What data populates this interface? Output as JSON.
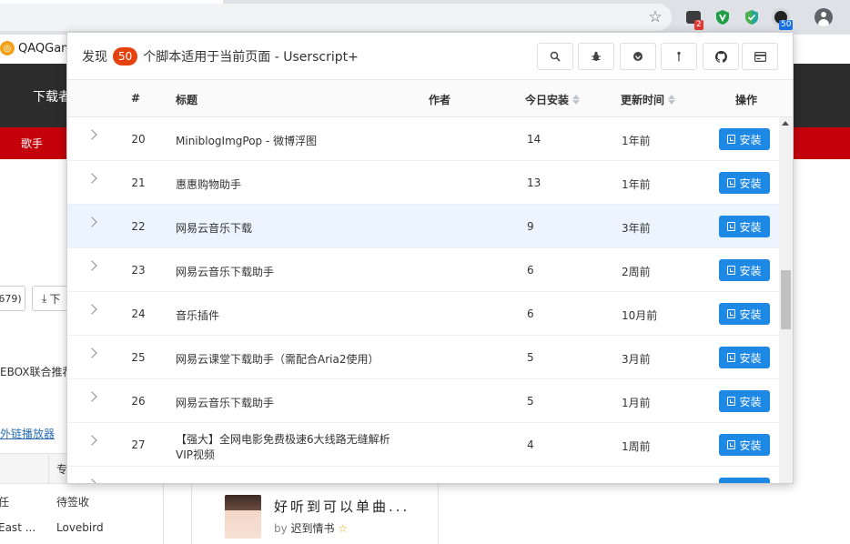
{
  "browser": {
    "ext_badge_1": "2",
    "ext_badge_2": "50",
    "star_icon": "☆"
  },
  "background_page": {
    "tab_title": "QAQGam",
    "nav_item": "下载者",
    "subnav_item": "歌手",
    "count_box": "679)",
    "download_button": "下",
    "text_1": "EBOX联合推荐",
    "link": "外链播放器",
    "table": {
      "header_cell": "专",
      "row1": [
        "任",
        "待签收"
      ],
      "row2": [
        "East ...",
        "Lovebird"
      ]
    },
    "card": {
      "title": "好听到可以单曲...",
      "by": "by",
      "author": "迟到情书"
    }
  },
  "popup": {
    "title_prefix": "发现",
    "count": "50",
    "title_suffix": "个脚本适用于当前页面 - Userscript+",
    "toolbar": [
      "search-icon",
      "bug-icon",
      "shield-icon",
      "pin-icon",
      "github-icon",
      "card-icon"
    ],
    "columns": {
      "num": "#",
      "title": "标题",
      "author": "作者",
      "installs": "今日安装",
      "updated": "更新时间",
      "action": "操作"
    },
    "install_label": "安装",
    "rows": [
      {
        "num": "20",
        "title": "MiniblogImgPop - 微博浮图",
        "installs": "14",
        "updated": "1年前"
      },
      {
        "num": "21",
        "title": "惠惠购物助手",
        "installs": "13",
        "updated": "1年前"
      },
      {
        "num": "22",
        "title": "网易云音乐下载",
        "installs": "9",
        "updated": "3年前"
      },
      {
        "num": "23",
        "title": "网易云音乐下载助手",
        "installs": "6",
        "updated": "2周前"
      },
      {
        "num": "24",
        "title": "音乐插件",
        "installs": "6",
        "updated": "10月前"
      },
      {
        "num": "25",
        "title": "网易云课堂下载助手（需配合Aria2使用）",
        "installs": "5",
        "updated": "3月前"
      },
      {
        "num": "26",
        "title": "网易云音乐下载助手",
        "installs": "5",
        "updated": "1月前"
      },
      {
        "num": "27",
        "title": "【强大】全网电影免费极速6大线路无缝解析VIP视频",
        "installs": "4",
        "updated": "1周前"
      }
    ],
    "hovered_row": "22"
  }
}
